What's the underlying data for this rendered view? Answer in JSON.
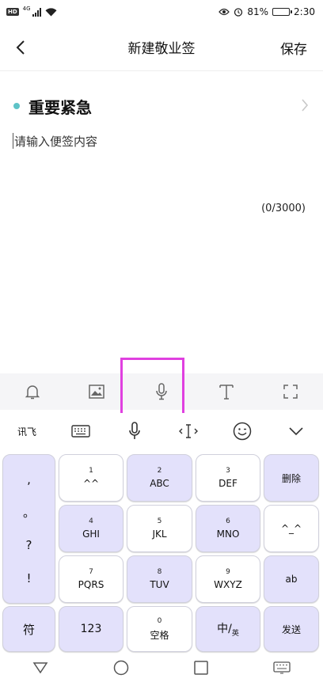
{
  "status_bar": {
    "hd": "HD",
    "network": "4G",
    "battery_percent": "81%",
    "battery_level": 0.81,
    "time": "2:30"
  },
  "header": {
    "title": "新建敬业签",
    "save_label": "保存"
  },
  "category": {
    "label": "重要紧急",
    "dot_color": "#5ec3c7"
  },
  "editor": {
    "placeholder": "请输入便签内容",
    "char_count": "(0/3000)"
  },
  "toolbar": {
    "icons": [
      "bell-icon",
      "image-icon",
      "microphone-icon",
      "text-format-icon",
      "fullscreen-icon"
    ]
  },
  "ime_bar": {
    "brand": "讯飞",
    "icons": [
      "keyboard-icon",
      "voice-icon",
      "cursor-icon",
      "emoji-icon",
      "collapse-icon"
    ]
  },
  "keyboard": {
    "punctuation": [
      ",",
      "。",
      "?",
      "!"
    ],
    "keys": {
      "k1": {
        "num": "1",
        "label": "^^"
      },
      "k2": {
        "num": "2",
        "label": "ABC"
      },
      "k3": {
        "num": "3",
        "label": "DEF"
      },
      "k4": {
        "num": "4",
        "label": "GHI"
      },
      "k5": {
        "num": "5",
        "label": "JKL"
      },
      "k6": {
        "num": "6",
        "label": "MNO"
      },
      "k7": {
        "num": "7",
        "label": "PQRS"
      },
      "k8": {
        "num": "8",
        "label": "TUV"
      },
      "k9": {
        "num": "9",
        "label": "WXYZ"
      },
      "k0": {
        "num": "0",
        "label": "空格"
      }
    },
    "delete": "删除",
    "face": "^_^",
    "ab": "ab",
    "symbol": "符",
    "numeric": "123",
    "lang_main": "中/",
    "lang_sub": "英",
    "send": "发送"
  }
}
